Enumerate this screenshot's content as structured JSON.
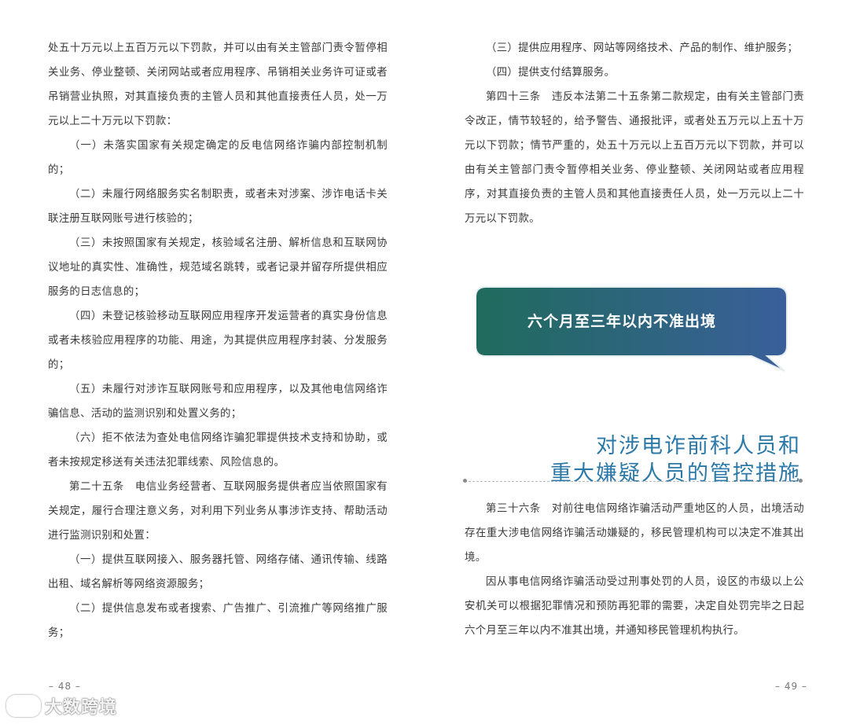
{
  "left": {
    "paragraphs": [
      "处五十万元以上五百万元以下罚款，并可以由有关主管部门责令暂停相关业务、停业整顿、关闭网站或者应用程序、吊销相关业务许可证或者吊销营业执照，对其直接负责的主管人员和其他直接责任人员，处一万元以上二十万元以下罚款：",
      "（一）未落实国家有关规定确定的反电信网络诈骗内部控制机制的；",
      "（二）未履行网络服务实名制职责，或者未对涉案、涉诈电话卡关联注册互联网账号进行核验的；",
      "（三）未按照国家有关规定，核验域名注册、解析信息和互联网协议地址的真实性、准确性，规范域名跳转，或者记录并留存所提供相应服务的日志信息的；",
      "（四）未登记核验移动互联网应用程序开发运营者的真实身份信息或者未核验应用程序的功能、用途，为其提供应用程序封装、分发服务的；",
      "（五）未履行对涉诈互联网账号和应用程序，以及其他电信网络诈骗信息、活动的监测识别和处置义务的；",
      "（六）拒不依法为查处电信网络诈骗犯罪提供技术支持和协助，或者未按规定移送有关违法犯罪线索、风险信息的。",
      "第二十五条　电信业务经营者、互联网服务提供者应当依照国家有关规定，履行合理注意义务，对利用下列业务从事涉诈支持、帮助活动进行监测识别和处置：",
      "（一）提供互联网接入、服务器托管、网络存储、通讯传输、线路出租、域名解析等网络资源服务；",
      "（二）提供信息发布或者搜索、广告推广、引流推广等网络推广服务；"
    ],
    "page_number": "– 48 –"
  },
  "right": {
    "paragraphs": [
      "（三）提供应用程序、网站等网络技术、产品的制作、维护服务；",
      "（四）提供支付结算服务。",
      "第四十三条　违反本法第二十五条第二款规定，由有关主管部门责令改正，情节较轻的，给予警告、通报批评，或者处五万元以上五十万元以下罚款；情节严重的，处五十万元以上五百万元以下罚款，并可以由有关主管部门责令暂停相关业务、停业整顿、关闭网站或者应用程序，对其直接负责的主管人员和其他直接责任人员，处一万元以上二十万元以下罚款。"
    ],
    "callout": "六个月至三年以内不准出境",
    "heading_line1": "对涉电诈前科人员和",
    "heading_line2": "重大嫌疑人员的管控措施",
    "body_paragraphs": [
      "第三十六条　对前往电信网络诈骗活动严重地区的人员，出境活动存在重大涉电信网络诈骗活动嫌疑的，移民管理机构可以决定不准其出境。",
      "因从事电信网络诈骗活动受过刑事处罚的人员，设区的市级以上公安机关可以根据犯罪情况和预防再犯罪的需要，决定自处罚完毕之日起六个月至三年以内不准其出境，并通知移民管理机构执行。"
    ],
    "page_number": "– 49 –"
  },
  "watermark": "大数跨境",
  "colors": {
    "heading": "#2b79a8",
    "callout_gradient_start": "#1f6b5c",
    "callout_gradient_end": "#3a5f9a"
  }
}
